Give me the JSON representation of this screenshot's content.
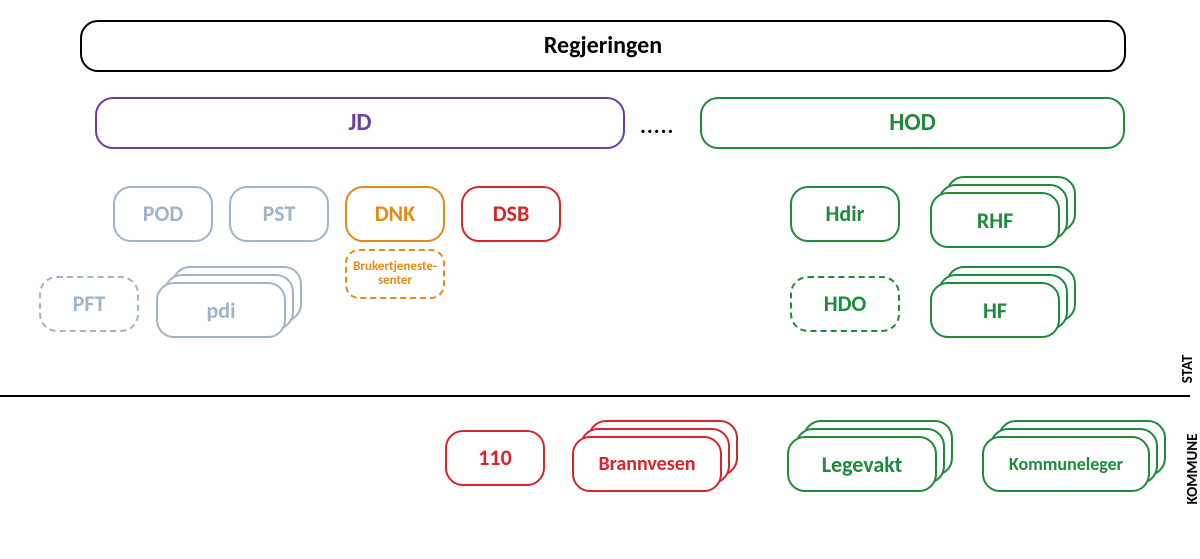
{
  "colors": {
    "black": "#000000",
    "purple": "#6a3ea1",
    "green": "#1f8a3b",
    "bluegray": "#9fb4ca",
    "orange": "#e38b1a",
    "red": "#d7252a"
  },
  "top": {
    "regjeringen": "Regjeringen"
  },
  "ministries": {
    "jd": "JD",
    "dots": ".....",
    "hod": "HOD"
  },
  "jd_row": {
    "pod": "POD",
    "pst": "PST",
    "dnk": "DNK",
    "dsb": "DSB"
  },
  "dnk_sub": "Brukertjeneste-\nsenter",
  "jd_lower": {
    "pft": "PFT",
    "pdi": "pdi"
  },
  "hod_row": {
    "hdir": "Hdir",
    "rhf": "RHF"
  },
  "hod_lower": {
    "hdo": "HDO",
    "hf": "HF"
  },
  "kommune": {
    "n110": "110",
    "brannvesen": "Brannvesen",
    "legevakt": "Legevakt",
    "kommuneleger": "Kommuneleger"
  },
  "side": {
    "stat": "STAT",
    "kommune": "KOMMUNE"
  }
}
